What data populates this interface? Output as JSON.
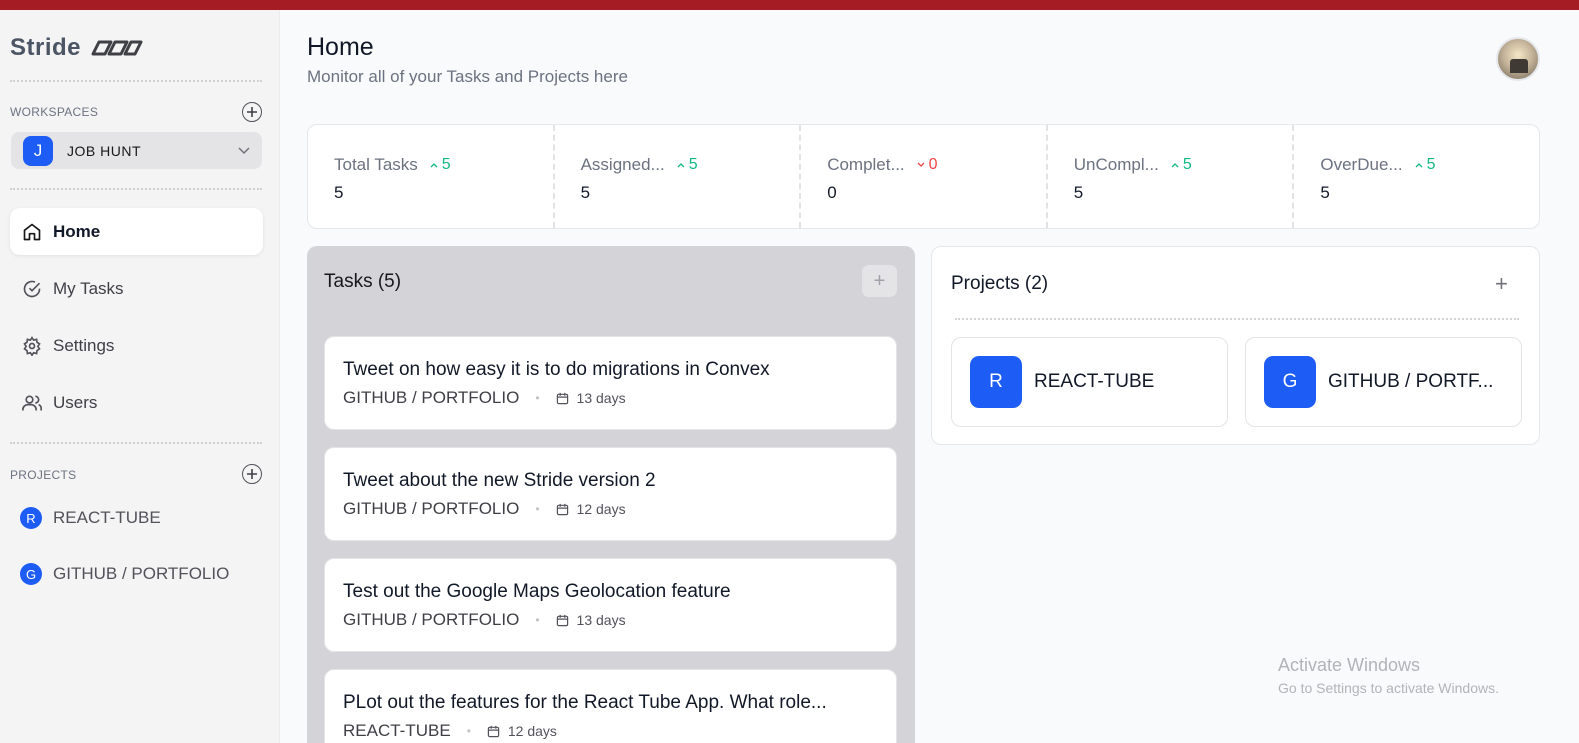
{
  "app": {
    "brand": "Stride",
    "accent_color": "#1d5cf5",
    "top_bar_color": "#a51c24"
  },
  "sidebar": {
    "workspaces_label": "WORKSPACES",
    "workspace": {
      "initial": "J",
      "name": "JOB HUNT"
    },
    "nav": [
      {
        "label": "Home",
        "icon": "home-icon",
        "active": true
      },
      {
        "label": "My Tasks",
        "icon": "check-circle-icon",
        "active": false
      },
      {
        "label": "Settings",
        "icon": "gear-icon",
        "active": false
      },
      {
        "label": "Users",
        "icon": "users-icon",
        "active": false
      }
    ],
    "projects_label": "PROJECTS",
    "projects": [
      {
        "initial": "R",
        "name": "REACT-TUBE"
      },
      {
        "initial": "G",
        "name": "GITHUB / PORTFOLIO"
      }
    ]
  },
  "header": {
    "title": "Home",
    "subtitle": "Monitor all of your Tasks and Projects here"
  },
  "stats": [
    {
      "label": "Total Tasks",
      "delta": "5",
      "trend": "up",
      "value": "5"
    },
    {
      "label": "Assigned...",
      "delta": "5",
      "trend": "up",
      "value": "5"
    },
    {
      "label": "Complet...",
      "delta": "0",
      "trend": "down",
      "value": "0"
    },
    {
      "label": "UnCompl...",
      "delta": "5",
      "trend": "up",
      "value": "5"
    },
    {
      "label": "OverDue...",
      "delta": "5",
      "trend": "up",
      "value": "5"
    }
  ],
  "tasks": {
    "title": "Tasks (5)",
    "add_label": "+",
    "items": [
      {
        "title": "Tweet on how easy it is to do migrations in Convex",
        "project": "GITHUB / PORTFOLIO",
        "due": "13 days"
      },
      {
        "title": "Tweet about the new Stride version 2",
        "project": "GITHUB / PORTFOLIO",
        "due": "12 days"
      },
      {
        "title": "Test out the Google Maps Geolocation feature",
        "project": "GITHUB / PORTFOLIO",
        "due": "13 days"
      },
      {
        "title": "PLot out the features for the React Tube App. What role...",
        "project": "REACT-TUBE",
        "due": "12 days"
      }
    ]
  },
  "projects": {
    "title": "Projects (2)",
    "add_label": "+",
    "items": [
      {
        "initial": "R",
        "name": "REACT-TUBE"
      },
      {
        "initial": "G",
        "name": "GITHUB / PORTF..."
      }
    ]
  },
  "watermark": {
    "line1": "Activate Windows",
    "line2": "Go to Settings to activate Windows."
  }
}
